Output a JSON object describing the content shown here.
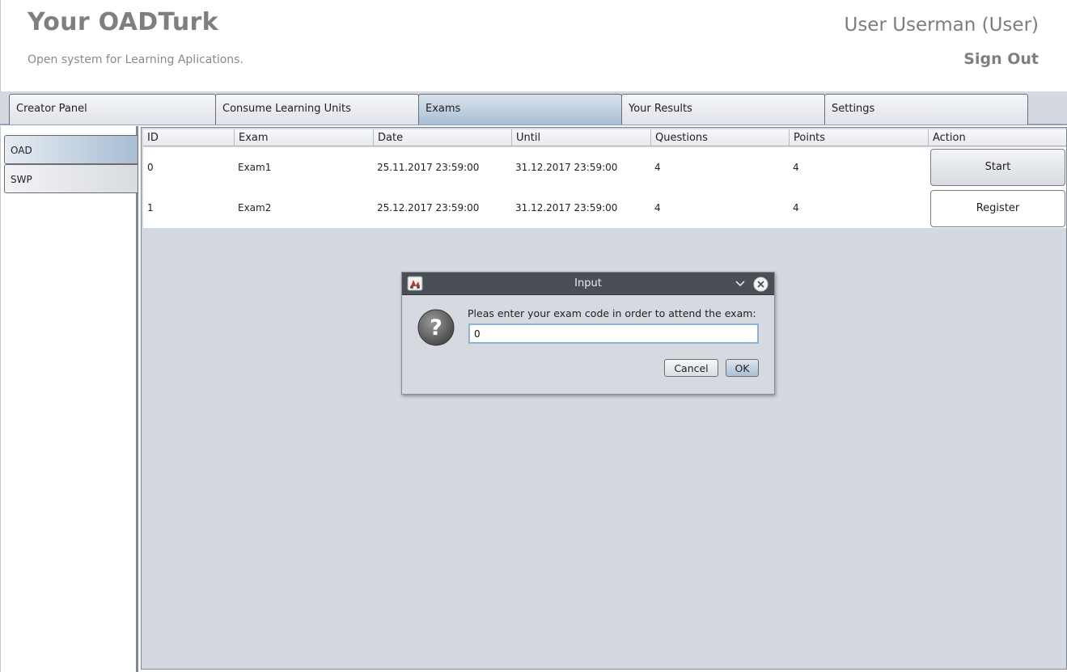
{
  "header": {
    "title": "Your OADTurk",
    "subtitle": "Open system for Learning Aplications.",
    "user": "User Userman (User)",
    "sign_out": "Sign Out"
  },
  "tabs": [
    {
      "label": "Creator Panel",
      "active": false
    },
    {
      "label": "Consume Learning Units",
      "active": false
    },
    {
      "label": "Exams",
      "active": true
    },
    {
      "label": "Your Results",
      "active": false
    },
    {
      "label": "Settings",
      "active": false
    }
  ],
  "side_tabs": [
    {
      "label": "OAD",
      "active": true
    },
    {
      "label": "SWP",
      "active": false
    }
  ],
  "table": {
    "columns": [
      "ID",
      "Exam",
      "Date",
      "Until",
      "Questions",
      "Points",
      "Action"
    ],
    "rows": [
      {
        "id": "0",
        "exam": "Exam1",
        "date": "25.11.2017 23:59:00",
        "until": "31.12.2017 23:59:00",
        "questions": "4",
        "points": "4",
        "action": "Start"
      },
      {
        "id": "1",
        "exam": "Exam2",
        "date": "25.12.2017 23:59:00",
        "until": "31.12.2017 23:59:00",
        "questions": "4",
        "points": "4",
        "action": "Register"
      }
    ]
  },
  "dialog": {
    "title": "Input",
    "message": "Pleas enter your exam code in order to attend the exam:",
    "input_value": "0",
    "cancel_label": "Cancel",
    "ok_label": "OK",
    "icon": "question-icon"
  },
  "colors": {
    "active_tab": "#a9bfd5",
    "dialog_titlebar": "#4a4f56",
    "background": "#d4d8e0"
  }
}
